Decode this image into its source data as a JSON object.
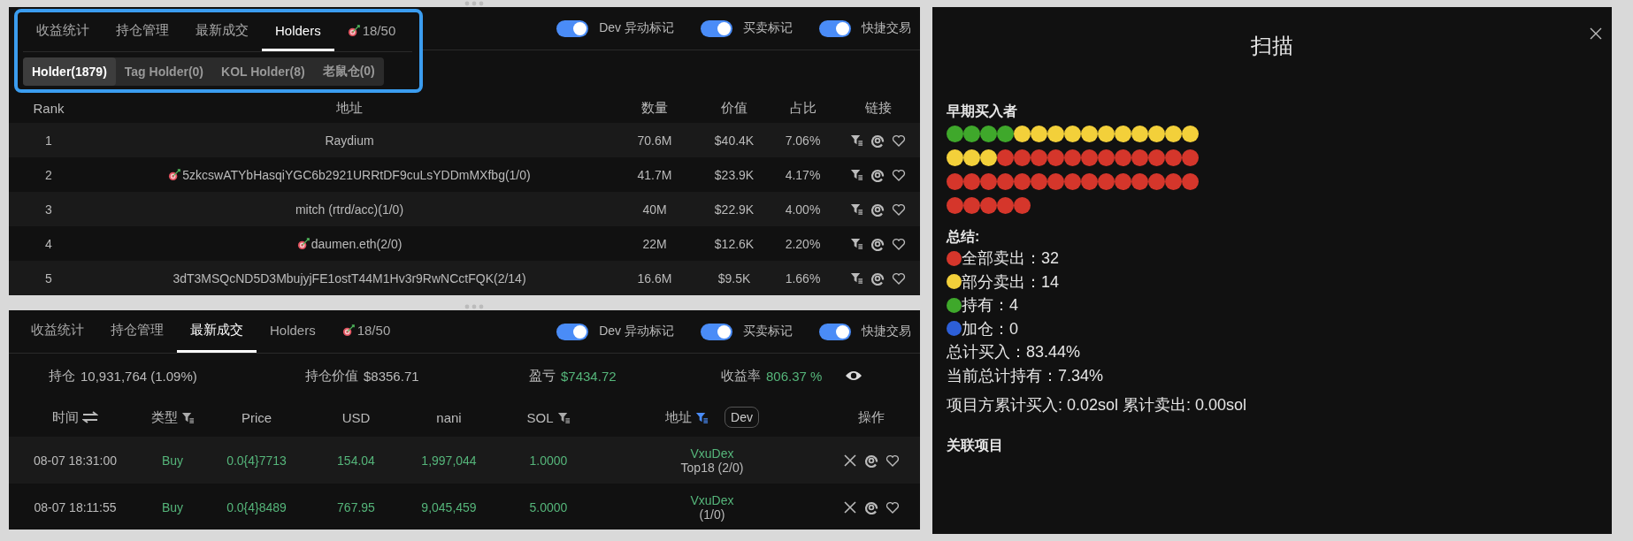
{
  "holders_panel": {
    "tabs": [
      {
        "label": "收益统计",
        "kind": "text",
        "selected": false
      },
      {
        "label": "持仓管理",
        "kind": "text",
        "selected": false
      },
      {
        "label": "最新成交",
        "kind": "text",
        "selected": false
      },
      {
        "label": "Holders",
        "kind": "text",
        "selected": true
      },
      {
        "label": "18/50",
        "kind": "target",
        "selected": false
      }
    ],
    "toggles": [
      {
        "label": "Dev 异动标记",
        "on": true
      },
      {
        "label": "买卖标记",
        "on": true
      },
      {
        "label": "快捷交易",
        "on": true
      }
    ],
    "subtabs": [
      {
        "label": "Holder(1879)",
        "selected": true
      },
      {
        "label": "Tag Holder(0)",
        "selected": false
      },
      {
        "label": "KOL Holder(8)",
        "selected": false
      },
      {
        "label": "老鼠仓(0)",
        "selected": false
      }
    ],
    "columns": [
      "Rank",
      "地址",
      "数量",
      "价值",
      "占比",
      "链接"
    ],
    "rows": [
      {
        "rank": "1",
        "address": "Raydium",
        "marked": false,
        "amount": "70.6M",
        "value": "$40.4K",
        "share": "7.06%"
      },
      {
        "rank": "2",
        "address": "5zkcswATYbHasqiYGC6b2921URRtDF9cuLsYDDmMXfbg(1/0)",
        "marked": true,
        "amount": "41.7M",
        "value": "$23.9K",
        "share": "4.17%"
      },
      {
        "rank": "3",
        "address": "mitch (rtrd/acc)(1/0)",
        "marked": false,
        "amount": "40M",
        "value": "$22.9K",
        "share": "4.00%"
      },
      {
        "rank": "4",
        "address": "daumen.eth(2/0)",
        "marked": true,
        "amount": "22M",
        "value": "$12.6K",
        "share": "2.20%"
      },
      {
        "rank": "5",
        "address": "3dT3MSQcND5D3MbujyjFE1ostT44M1Hv3r9RwNCctFQK(2/14)",
        "marked": false,
        "amount": "16.6M",
        "value": "$9.5K",
        "share": "1.66%"
      }
    ]
  },
  "trades_panel": {
    "tabs": [
      {
        "label": "收益统计",
        "kind": "text",
        "selected": false
      },
      {
        "label": "持仓管理",
        "kind": "text",
        "selected": false
      },
      {
        "label": "最新成交",
        "kind": "text",
        "selected": true
      },
      {
        "label": "Holders",
        "kind": "text",
        "selected": false
      },
      {
        "label": "18/50",
        "kind": "target",
        "selected": false
      }
    ],
    "toggles": [
      {
        "label": "Dev 异动标记",
        "on": true
      },
      {
        "label": "买卖标记",
        "on": true
      },
      {
        "label": "快捷交易",
        "on": true
      }
    ],
    "stats": [
      {
        "label": "持仓",
        "value": "10,931,764 (1.09%)",
        "kind": "plain"
      },
      {
        "label": "持仓价值",
        "value": "$8356.71",
        "kind": "plain"
      },
      {
        "label": "盈亏",
        "value": "$7434.72",
        "kind": "gain"
      },
      {
        "label": "收益率",
        "value": "806.37 %",
        "kind": "gain"
      }
    ],
    "columns": [
      {
        "label": "时间",
        "kind": "swap"
      },
      {
        "label": "类型",
        "kind": "filter",
        "active": false
      },
      {
        "label": "Price",
        "kind": "plain"
      },
      {
        "label": "USD",
        "kind": "plain"
      },
      {
        "label": "nani",
        "kind": "plain"
      },
      {
        "label": "SOL",
        "kind": "filter",
        "active": false
      },
      {
        "label": "地址",
        "kind": "filter",
        "active": true,
        "tag": "Dev"
      },
      {
        "label": "操作",
        "kind": "plain"
      }
    ],
    "rows": [
      {
        "time": "08-07 18:31:00",
        "type": "Buy",
        "price": "0.0{4}7713",
        "usd": "154.04",
        "amount": "1,997,044",
        "sol": "1.0000",
        "address": "VxuDex",
        "note": "Top18 (2/0)"
      },
      {
        "time": "08-07 18:11:55",
        "type": "Buy",
        "price": "0.0{4}8489",
        "usd": "767.95",
        "amount": "9,045,459",
        "sol": "5.0000",
        "address": "VxuDex",
        "note": "(1/0)"
      }
    ]
  },
  "scan_dialog": {
    "title": "扫描",
    "early_buyers": {
      "title": "早期买入者",
      "dots": [
        {
          "color": "#3fa82b"
        },
        {
          "color": "#3fa82b"
        },
        {
          "color": "#3fa82b"
        },
        {
          "color": "#3fa82b"
        },
        {
          "color": "#f3d03a"
        },
        {
          "color": "#f3d03a"
        },
        {
          "color": "#f3d03a"
        },
        {
          "color": "#f3d03a"
        },
        {
          "color": "#f3d03a"
        },
        {
          "color": "#f3d03a"
        },
        {
          "color": "#f3d03a"
        },
        {
          "color": "#f3d03a"
        },
        {
          "color": "#f3d03a"
        },
        {
          "color": "#f3d03a"
        },
        {
          "color": "#f3d03a"
        },
        {
          "color": "#f3d03a"
        },
        {
          "color": "#f3d03a"
        },
        {
          "color": "#f3d03a"
        },
        {
          "color": "#d5362b"
        },
        {
          "color": "#d5362b"
        },
        {
          "color": "#d5362b"
        },
        {
          "color": "#d5362b"
        },
        {
          "color": "#d5362b"
        },
        {
          "color": "#d5362b"
        },
        {
          "color": "#d5362b"
        },
        {
          "color": "#d5362b"
        },
        {
          "color": "#d5362b"
        },
        {
          "color": "#d5362b"
        },
        {
          "color": "#d5362b"
        },
        {
          "color": "#d5362b"
        },
        {
          "color": "#d5362b"
        },
        {
          "color": "#d5362b"
        },
        {
          "color": "#d5362b"
        },
        {
          "color": "#d5362b"
        },
        {
          "color": "#d5362b"
        },
        {
          "color": "#d5362b"
        },
        {
          "color": "#d5362b"
        },
        {
          "color": "#d5362b"
        },
        {
          "color": "#d5362b"
        },
        {
          "color": "#d5362b"
        },
        {
          "color": "#d5362b"
        },
        {
          "color": "#d5362b"
        },
        {
          "color": "#d5362b"
        },
        {
          "color": "#d5362b"
        },
        {
          "color": "#d5362b"
        },
        {
          "color": "#d5362b"
        },
        {
          "color": "#d5362b"
        },
        {
          "color": "#d5362b"
        },
        {
          "color": "#d5362b"
        },
        {
          "color": "#d5362b"
        }
      ]
    },
    "summary": {
      "title": "总结:",
      "items": [
        {
          "text": "全部卖出：32",
          "color": "#d5362b"
        },
        {
          "text": "部分卖出：14",
          "color": "#f3d03a"
        },
        {
          "text": "持有：4",
          "color": "#3fa82b"
        },
        {
          "text": "加仓：0",
          "color": "#2d5fd8"
        },
        {
          "text": "总计买入：83.44%"
        },
        {
          "text": "当前总计持有：7.34%"
        }
      ]
    },
    "project_line": "项目方累计买入: 0.02sol 累计卖出: 0.00sol",
    "related_title": "关联项目"
  }
}
